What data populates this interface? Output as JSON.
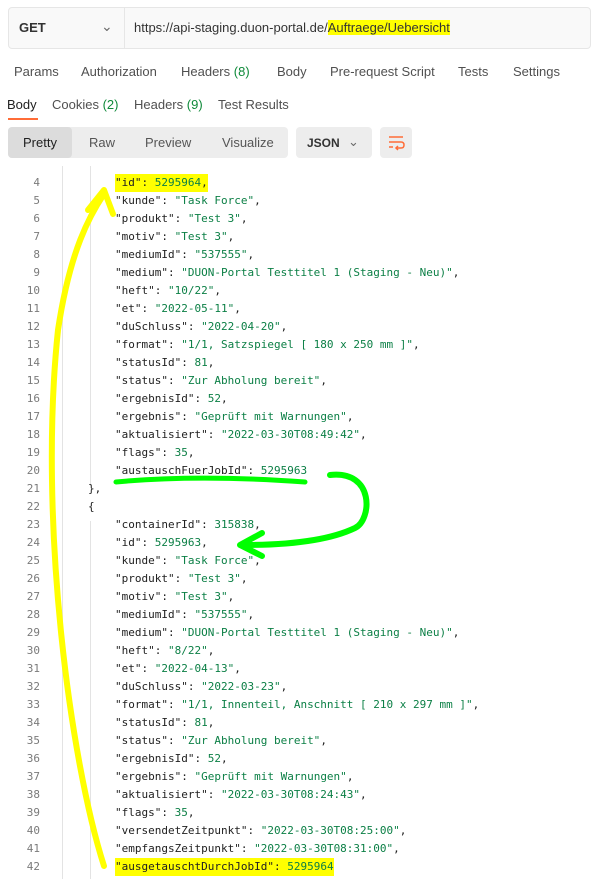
{
  "request": {
    "method": "GET",
    "url_prefix": "https://api-staging.duon-portal.de/",
    "url_highlight": "Auftraege/Uebersicht"
  },
  "request_tabs": [
    {
      "label": "Params"
    },
    {
      "label": "Authorization"
    },
    {
      "label": "Headers",
      "count": "(8)"
    },
    {
      "label": "Body"
    },
    {
      "label": "Pre-request Script"
    },
    {
      "label": "Tests"
    },
    {
      "label": "Settings"
    }
  ],
  "response_tabs": [
    {
      "label": "Body"
    },
    {
      "label": "Cookies",
      "count": "(2)"
    },
    {
      "label": "Headers",
      "count": "(9)"
    },
    {
      "label": "Test Results"
    }
  ],
  "view_modes": [
    "Pretty",
    "Raw",
    "Preview",
    "Visualize"
  ],
  "format": "JSON",
  "code_lines": [
    {
      "n": "4",
      "indent": 2,
      "key": "\"id\"",
      "val": "5295964",
      "vt": "n",
      "tail": ",",
      "hl": true
    },
    {
      "n": "5",
      "indent": 2,
      "key": "\"kunde\"",
      "val": "\"Task Force\"",
      "vt": "s",
      "tail": ","
    },
    {
      "n": "6",
      "indent": 2,
      "key": "\"produkt\"",
      "val": "\"Test 3\"",
      "vt": "s",
      "tail": ","
    },
    {
      "n": "7",
      "indent": 2,
      "key": "\"motiv\"",
      "val": "\"Test 3\"",
      "vt": "s",
      "tail": ","
    },
    {
      "n": "8",
      "indent": 2,
      "key": "\"mediumId\"",
      "val": "\"537555\"",
      "vt": "s",
      "tail": ","
    },
    {
      "n": "9",
      "indent": 2,
      "key": "\"medium\"",
      "val": "\"DUON-Portal Testtitel 1 (Staging - Neu)\"",
      "vt": "s",
      "tail": ","
    },
    {
      "n": "10",
      "indent": 2,
      "key": "\"heft\"",
      "val": "\"10/22\"",
      "vt": "s",
      "tail": ","
    },
    {
      "n": "11",
      "indent": 2,
      "key": "\"et\"",
      "val": "\"2022-05-11\"",
      "vt": "s",
      "tail": ","
    },
    {
      "n": "12",
      "indent": 2,
      "key": "\"duSchluss\"",
      "val": "\"2022-04-20\"",
      "vt": "s",
      "tail": ","
    },
    {
      "n": "13",
      "indent": 2,
      "key": "\"format\"",
      "val": "\"1/1, Satzspiegel [ 180 x 250 mm ]\"",
      "vt": "s",
      "tail": ","
    },
    {
      "n": "14",
      "indent": 2,
      "key": "\"statusId\"",
      "val": "81",
      "vt": "n",
      "tail": ","
    },
    {
      "n": "15",
      "indent": 2,
      "key": "\"status\"",
      "val": "\"Zur Abholung bereit\"",
      "vt": "s",
      "tail": ","
    },
    {
      "n": "16",
      "indent": 2,
      "key": "\"ergebnisId\"",
      "val": "52",
      "vt": "n",
      "tail": ","
    },
    {
      "n": "17",
      "indent": 2,
      "key": "\"ergebnis\"",
      "val": "\"Geprüft mit Warnungen\"",
      "vt": "s",
      "tail": ","
    },
    {
      "n": "18",
      "indent": 2,
      "key": "\"aktualisiert\"",
      "val": "\"2022-03-30T08:49:42\"",
      "vt": "s",
      "tail": ","
    },
    {
      "n": "19",
      "indent": 2,
      "key": "\"flags\"",
      "val": "35",
      "vt": "n",
      "tail": ","
    },
    {
      "n": "20",
      "indent": 2,
      "key": "\"austauschFuerJobId\"",
      "val": "5295963",
      "vt": "n",
      "tail": ""
    },
    {
      "n": "21",
      "indent": 1,
      "punct": "},"
    },
    {
      "n": "22",
      "indent": 1,
      "punct": "{"
    },
    {
      "n": "23",
      "indent": 2,
      "key": "\"containerId\"",
      "val": "315838",
      "vt": "n",
      "tail": ","
    },
    {
      "n": "24",
      "indent": 2,
      "key": "\"id\"",
      "val": "5295963",
      "vt": "n",
      "tail": ","
    },
    {
      "n": "25",
      "indent": 2,
      "key": "\"kunde\"",
      "val": "\"Task Force\"",
      "vt": "s",
      "tail": ","
    },
    {
      "n": "26",
      "indent": 2,
      "key": "\"produkt\"",
      "val": "\"Test 3\"",
      "vt": "s",
      "tail": ","
    },
    {
      "n": "27",
      "indent": 2,
      "key": "\"motiv\"",
      "val": "\"Test 3\"",
      "vt": "s",
      "tail": ","
    },
    {
      "n": "28",
      "indent": 2,
      "key": "\"mediumId\"",
      "val": "\"537555\"",
      "vt": "s",
      "tail": ","
    },
    {
      "n": "29",
      "indent": 2,
      "key": "\"medium\"",
      "val": "\"DUON-Portal Testtitel 1 (Staging - Neu)\"",
      "vt": "s",
      "tail": ","
    },
    {
      "n": "30",
      "indent": 2,
      "key": "\"heft\"",
      "val": "\"8/22\"",
      "vt": "s",
      "tail": ","
    },
    {
      "n": "31",
      "indent": 2,
      "key": "\"et\"",
      "val": "\"2022-04-13\"",
      "vt": "s",
      "tail": ","
    },
    {
      "n": "32",
      "indent": 2,
      "key": "\"duSchluss\"",
      "val": "\"2022-03-23\"",
      "vt": "s",
      "tail": ","
    },
    {
      "n": "33",
      "indent": 2,
      "key": "\"format\"",
      "val": "\"1/1, Innenteil, Anschnitt [ 210 x 297 mm ]\"",
      "vt": "s",
      "tail": ","
    },
    {
      "n": "34",
      "indent": 2,
      "key": "\"statusId\"",
      "val": "81",
      "vt": "n",
      "tail": ","
    },
    {
      "n": "35",
      "indent": 2,
      "key": "\"status\"",
      "val": "\"Zur Abholung bereit\"",
      "vt": "s",
      "tail": ","
    },
    {
      "n": "36",
      "indent": 2,
      "key": "\"ergebnisId\"",
      "val": "52",
      "vt": "n",
      "tail": ","
    },
    {
      "n": "37",
      "indent": 2,
      "key": "\"ergebnis\"",
      "val": "\"Geprüft mit Warnungen\"",
      "vt": "s",
      "tail": ","
    },
    {
      "n": "38",
      "indent": 2,
      "key": "\"aktualisiert\"",
      "val": "\"2022-03-30T08:24:43\"",
      "vt": "s",
      "tail": ","
    },
    {
      "n": "39",
      "indent": 2,
      "key": "\"flags\"",
      "val": "35",
      "vt": "n",
      "tail": ","
    },
    {
      "n": "40",
      "indent": 2,
      "key": "\"versendetZeitpunkt\"",
      "val": "\"2022-03-30T08:25:00\"",
      "vt": "s",
      "tail": ","
    },
    {
      "n": "41",
      "indent": 2,
      "key": "\"empfangsZeitpunkt\"",
      "val": "\"2022-03-30T08:31:00\"",
      "vt": "s",
      "tail": ","
    },
    {
      "n": "42",
      "indent": 2,
      "key": "\"ausgetauschtDurchJobId\"",
      "val": "5295964",
      "vt": "n",
      "tail": "",
      "hl": true
    }
  ],
  "colors": {
    "highlight_yellow": "#ffff00",
    "annotation_green": "#00ff00",
    "accent": "#ff6c37",
    "value_green": "#0b7f45"
  }
}
